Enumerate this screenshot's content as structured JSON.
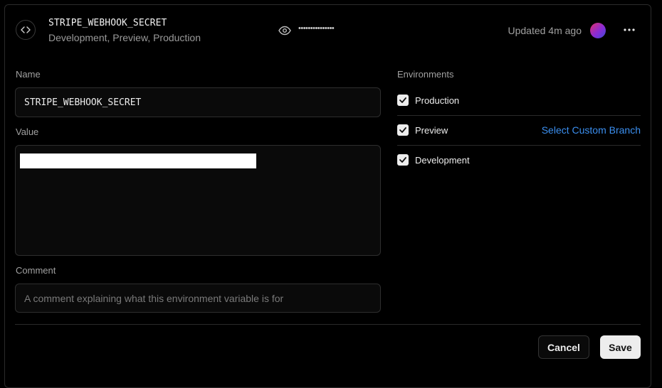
{
  "header": {
    "variable_name": "STRIPE_WEBHOOK_SECRET",
    "environments_summary": "Development, Preview, Production",
    "masked_value": "•••••••••••••••",
    "updated_text": "Updated 4m ago"
  },
  "form": {
    "name_label": "Name",
    "name_value": "STRIPE_WEBHOOK_SECRET",
    "value_label": "Value",
    "comment_label": "Comment",
    "comment_placeholder": "A comment explaining what this environment variable is for"
  },
  "environments": {
    "label": "Environments",
    "items": [
      {
        "label": "Production",
        "checked": true
      },
      {
        "label": "Preview",
        "checked": true,
        "action": "Select Custom Branch"
      },
      {
        "label": "Development",
        "checked": true
      }
    ]
  },
  "actions": {
    "cancel_label": "Cancel",
    "save_label": "Save"
  },
  "colors": {
    "accent_link": "#3b8ff0",
    "background": "#000000"
  }
}
